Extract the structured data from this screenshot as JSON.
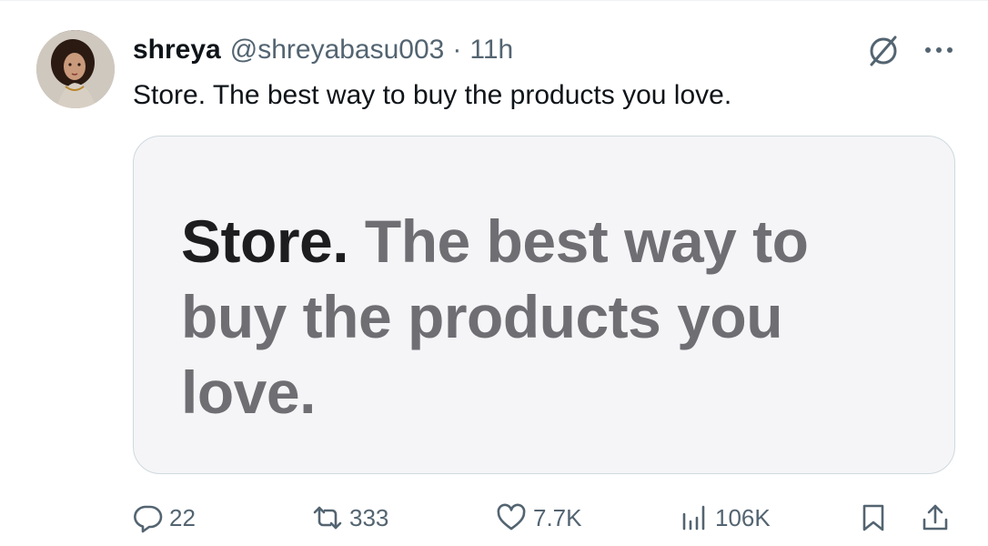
{
  "author": {
    "name": "shreya",
    "handle": "@shreyabasu003",
    "separator": "·",
    "time": "11h",
    "avatar_icon": "profile-photo"
  },
  "post": {
    "text": "Store. The best way to buy the products you love."
  },
  "card": {
    "headline_strong": "Store.",
    "headline_soft": " The best way to buy the products you love.",
    "background": "#f5f5f7",
    "strong_color": "#1d1d1f",
    "soft_color": "#6e6e73"
  },
  "header_icons": {
    "grok": "grok-icon",
    "more": "more-icon"
  },
  "actions": {
    "replies": "22",
    "reposts": "333",
    "likes": "7.7K",
    "views": "106K"
  },
  "colors": {
    "text_primary": "#0f1419",
    "text_secondary": "#536471",
    "border": "#cfd9de"
  }
}
